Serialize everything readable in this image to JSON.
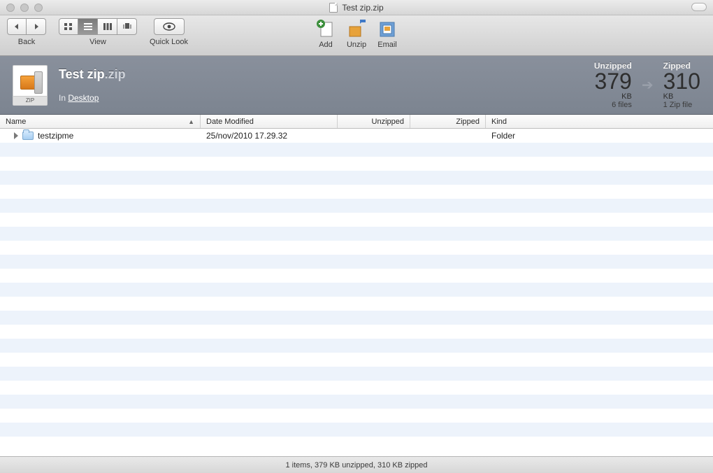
{
  "window_title": "Test zip.zip",
  "toolbar": {
    "back_label": "Back",
    "view_label": "View",
    "quicklook_label": "Quick Look",
    "add_label": "Add",
    "unzip_label": "Unzip",
    "email_label": "Email"
  },
  "info": {
    "file_base": "Test zip",
    "file_ext": ".zip",
    "in_prefix": "In ",
    "location": "Desktop",
    "zip_badge": "ZIP",
    "unzipped_label": "Unzipped",
    "zipped_label": "Zipped",
    "unzipped_size": "379",
    "unzipped_unit": "KB",
    "unzipped_sub": "6 files",
    "zipped_size": "310",
    "zipped_unit": "KB",
    "zipped_sub": "1 Zip file"
  },
  "columns": {
    "name": "Name",
    "date": "Date Modified",
    "unzipped": "Unzipped",
    "zipped": "Zipped",
    "kind": "Kind"
  },
  "rows": [
    {
      "name": "testzipme",
      "date": "25/nov/2010 17.29.32",
      "unzipped": "",
      "zipped": "",
      "kind": "Folder"
    }
  ],
  "status": "1 items, 379 KB unzipped, 310 KB zipped"
}
